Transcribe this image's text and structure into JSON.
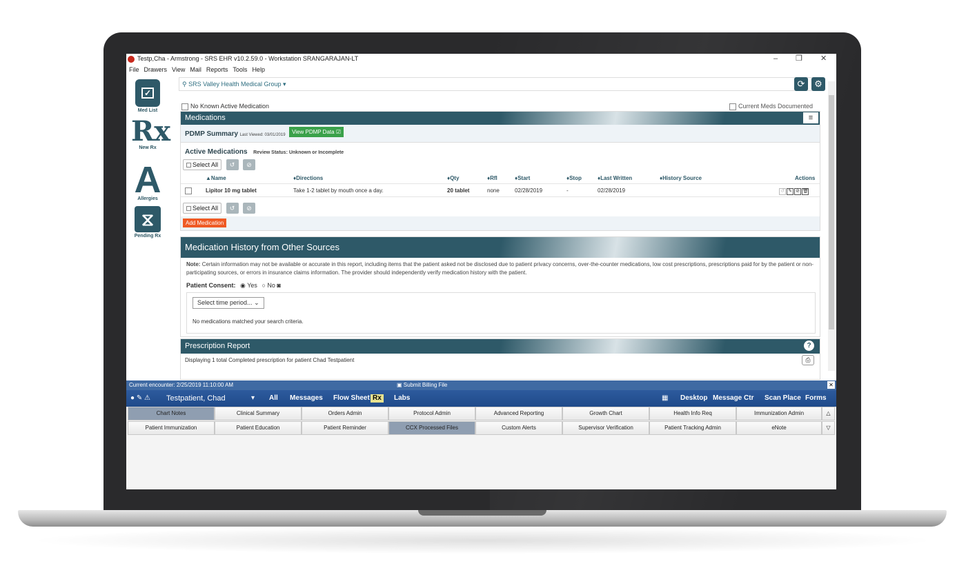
{
  "window": {
    "title": "Testp,Cha - Armstrong - SRS EHR v10.2.59.0 -  Workstation SRANGARAJAN-LT",
    "minimize": "–",
    "restore": "❐",
    "close": "✕"
  },
  "menu": [
    "File",
    "Drawers",
    "View",
    "Mail",
    "Reports",
    "Tools",
    "Help"
  ],
  "left_nav": {
    "med_list": "Med List",
    "new_rx": "New Rx",
    "rx_glyph": "Rx",
    "allergies": "Allergies",
    "allergies_glyph": "A",
    "pending_rx": "Pending Rx"
  },
  "location": "SRS Valley Health Medical Group ▾",
  "no_known": "No Known Active Medication",
  "current_meds": "Current Meds Documented",
  "medications": {
    "title": "Medications",
    "pdmp_label": "PDMP Summary",
    "pdmp_last": "Last Viewed: 03/01/2019",
    "pdmp_button": "View PDMP Data",
    "active_title": "Active Medications",
    "review_status": "Review Status: Unknown or Incomplete",
    "select_all": "Select All",
    "columns": [
      "▲Name",
      "♦Directions",
      "♦Qty",
      "♦Rfl",
      "♦Start",
      "♦Stop",
      "♦Last Written",
      "♦History Source",
      "Actions"
    ],
    "rows": [
      {
        "name": "Lipitor 10 mg tablet",
        "directions": "Take 1-2 tablet by mouth once a day.",
        "qty": "20 tablet",
        "rfl": "none",
        "start": "02/28/2019",
        "stop": "-",
        "last_written": "02/28/2019",
        "history": ""
      }
    ],
    "add_button": "Add Medication"
  },
  "history": {
    "title": "Medication History from Other Sources",
    "note_label": "Note:",
    "note_text": "Certain information may not be available or accurate in this report, including items that the patient asked not be disclosed due to patient privacy concerns, over-the-counter medications, low cost prescriptions, prescriptions paid for by the patient or non-participating sources, or errors in insurance claims information. The provider should independently verify medication history with the patient.",
    "consent_label": "Patient Consent:",
    "yes": "Yes",
    "no": "No",
    "select_period": "Select time period...",
    "empty": "No medications matched your search criteria."
  },
  "report": {
    "title": "Prescription Report",
    "text": "Displaying 1 total Completed prescription for patient Chad Testpatient"
  },
  "encounter": {
    "label": "Current encounter:  2/25/2019 11:10:00 AM",
    "billing": "Submit Billing File"
  },
  "patient_bar": {
    "name": "Testpatient, Chad",
    "left_items": [
      "All",
      "Messages",
      "Flow Sheet",
      "Rx",
      "Labs"
    ],
    "right_items": [
      "Desktop",
      "Message Ctr",
      "Scan Place",
      "Forms"
    ]
  },
  "tabs_row1": [
    "Chart Notes",
    "Clinical Summary",
    "Orders Admin",
    "Protocol Admin",
    "Advanced Reporting",
    "Growth Chart",
    "Health Info Req",
    "Immunization Admin"
  ],
  "tabs_row2": [
    "Patient Immunization",
    "Patient Education",
    "Patient Reminder",
    "CCX Processed Files",
    "Custom Alerts",
    "Supervisor Verification",
    "Patient Tracking Admin",
    "eNote"
  ],
  "colors": {
    "header": "#2e5968",
    "accent_green": "#3aa14a",
    "accent_orange": "#ef5a24",
    "patient_bar": "#2d5a9d"
  }
}
